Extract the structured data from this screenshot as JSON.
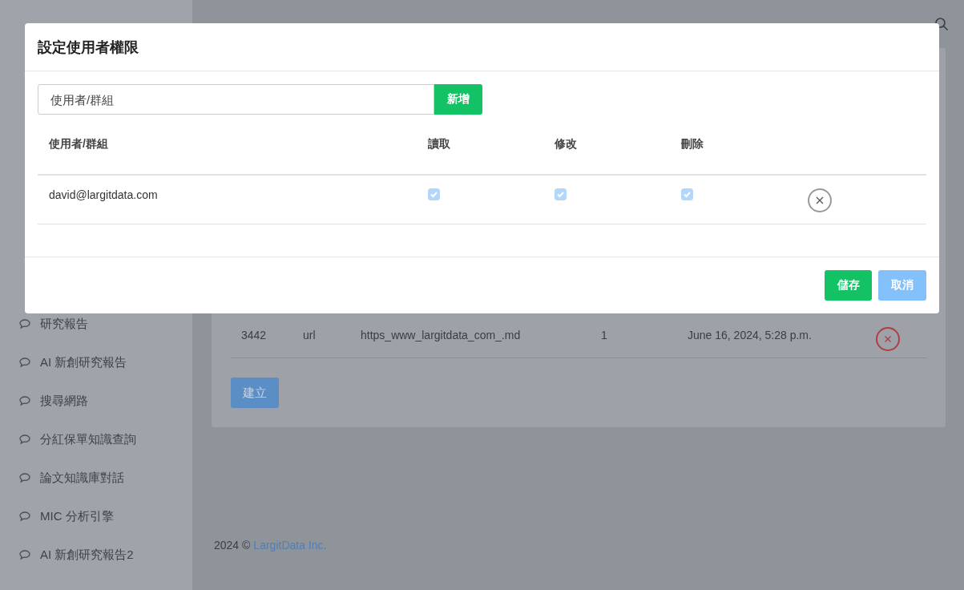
{
  "sidebar": {
    "items": [
      {
        "label": "研究報告"
      },
      {
        "label": "AI 新創研究報告"
      },
      {
        "label": "搜尋網路"
      },
      {
        "label": "分紅保單知識查詢"
      },
      {
        "label": "論文知識庫對話"
      },
      {
        "label": "MIC 分析引擎"
      },
      {
        "label": "AI 新創研究報告2"
      }
    ]
  },
  "main": {
    "table": {
      "rows": [
        {
          "cells": [
            "3442",
            "url",
            "https_www_largitdata_com_.md",
            "1",
            "June 16, 2024, 5:28 p.m."
          ]
        }
      ]
    },
    "create_button": "建立"
  },
  "footer": {
    "text": "2024 ©",
    "link": "LargitData Inc."
  },
  "modal": {
    "title": "設定使用者權限",
    "input": {
      "placeholder": "使用者/群組"
    },
    "add_button": "新增",
    "columns": [
      "使用者/群組",
      "讀取",
      "修改",
      "刪除"
    ],
    "rows": [
      {
        "user": "david@largitdata.com",
        "read": true,
        "edit": true,
        "delete": true
      }
    ],
    "save_button": "儲存",
    "cancel_button": "取消"
  }
}
